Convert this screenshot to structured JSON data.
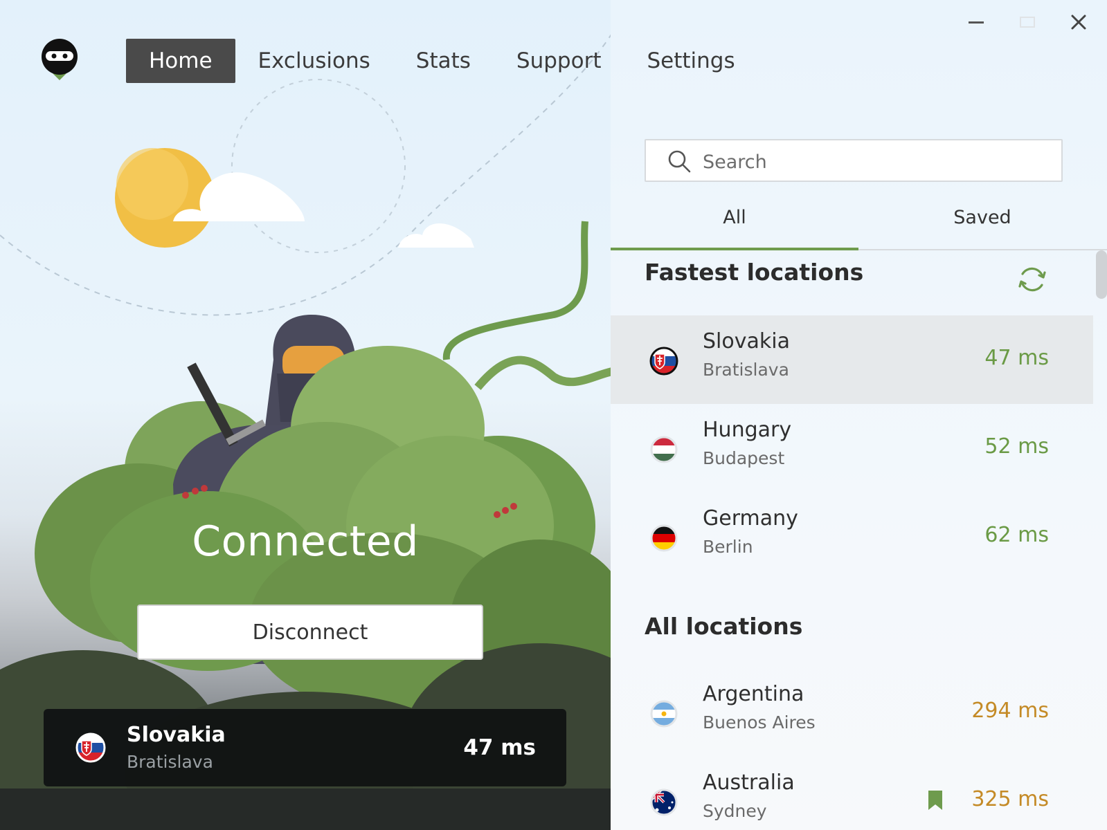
{
  "window": {
    "minimize_label": "Minimize",
    "maximize_label": "Maximize",
    "close_label": "Close"
  },
  "nav": {
    "tabs": [
      {
        "label": "Home",
        "active": true
      },
      {
        "label": "Exclusions",
        "active": false
      },
      {
        "label": "Stats",
        "active": false
      },
      {
        "label": "Support",
        "active": false
      },
      {
        "label": "Settings",
        "active": false
      }
    ]
  },
  "status": {
    "title": "Connected",
    "disconnect_label": "Disconnect",
    "current": {
      "country": "Slovakia",
      "city": "Bratislava",
      "ping": "47 ms",
      "flag": "flag-slovakia-icon"
    }
  },
  "search": {
    "placeholder": "Search",
    "value": ""
  },
  "list_tabs": [
    {
      "label": "All",
      "active": true
    },
    {
      "label": "Saved",
      "active": false
    }
  ],
  "fastest": {
    "title": "Fastest locations",
    "items": [
      {
        "country": "Slovakia",
        "city": "Bratislava",
        "ping": "47 ms",
        "flag": "flag-slovakia-icon",
        "selected": true
      },
      {
        "country": "Hungary",
        "city": "Budapest",
        "ping": "52 ms",
        "flag": "flag-hungary-icon",
        "selected": false
      },
      {
        "country": "Germany",
        "city": "Berlin",
        "ping": "62 ms",
        "flag": "flag-germany-icon",
        "selected": false
      }
    ]
  },
  "all": {
    "title": "All locations",
    "items": [
      {
        "country": "Argentina",
        "city": "Buenos Aires",
        "ping": "294 ms",
        "flag": "flag-argentina-icon",
        "saved": false
      },
      {
        "country": "Australia",
        "city": "Sydney",
        "ping": "325 ms",
        "flag": "flag-australia-icon",
        "saved": true
      }
    ]
  },
  "colors": {
    "accent_green": "#6e9b4d",
    "ping_good": "#6a9a45",
    "ping_slow": "#c48a26",
    "nav_active_bg": "#4a4a4a"
  }
}
